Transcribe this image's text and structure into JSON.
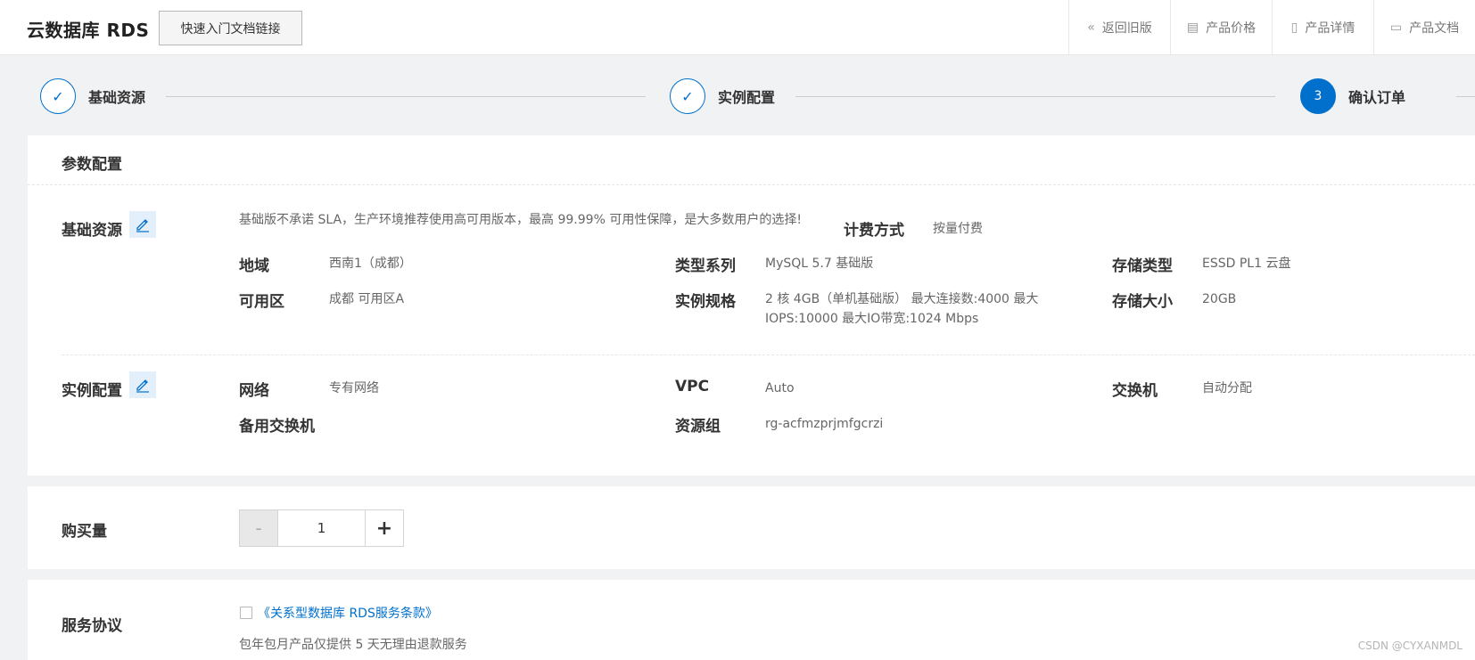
{
  "header": {
    "title": "云数据库 RDS",
    "quick_link": "快速入门文档链接",
    "nav": [
      {
        "label": "返回旧版",
        "icon": "double-chevron-left-icon",
        "glyph": "«"
      },
      {
        "label": "产品价格",
        "icon": "price-list-icon",
        "glyph": "▤"
      },
      {
        "label": "产品详情",
        "icon": "detail-doc-icon",
        "glyph": "▯"
      },
      {
        "label": "产品文档",
        "icon": "document-icon",
        "glyph": "▭"
      }
    ]
  },
  "steps": [
    {
      "label": "基础资源",
      "state": "done",
      "mark": "✓"
    },
    {
      "label": "实例配置",
      "state": "done",
      "mark": "✓"
    },
    {
      "label": "确认订单",
      "state": "active",
      "mark": "3"
    }
  ],
  "params": {
    "title": "参数配置",
    "basic": {
      "label": "基础资源",
      "notice": "基础版不承诺 SLA，生产环境推荐使用高可用版本，最高 99.99% 可用性保障，是大多数用户的选择!",
      "billing_label": "计费方式",
      "billing_value": "按量付费",
      "region_label": "地域",
      "region_value": "西南1（成都）",
      "zone_label": "可用区",
      "zone_value": "成都 可用区A",
      "series_label": "类型系列",
      "series_value": "MySQL 5.7 基础版",
      "spec_label": "实例规格",
      "spec_value_line1": "2 核 4GB（单机基础版）   最大连接数:4000 最大",
      "spec_value_line2": "IOPS:10000 最大IO带宽:1024 Mbps",
      "storage_type_label": "存储类型",
      "storage_type_value": "ESSD PL1 云盘",
      "storage_size_label": "存储大小",
      "storage_size_value": "20GB"
    },
    "instance": {
      "label": "实例配置",
      "network_label": "网络",
      "network_value": "专有网络",
      "vpc_label": "VPC",
      "vpc_value": "Auto",
      "switch_label": "交换机",
      "switch_value": "自动分配",
      "backup_switch_label": "备用交换机",
      "resource_group_label": "资源组",
      "resource_group_value": "rg-acfmzprjmfgcrzi"
    }
  },
  "purchase": {
    "label": "购买量",
    "minus": "-",
    "quantity": "1",
    "plus": "+"
  },
  "agreement": {
    "label": "服务协议",
    "link": "《关系型数据库 RDS服务条款》",
    "note": "包年包月产品仅提供 5 天无理由退款服务"
  },
  "watermark": "CSDN @CYXANMDL",
  "colors": {
    "accent": "#0070cc",
    "edit_bg": "#e3effa"
  }
}
